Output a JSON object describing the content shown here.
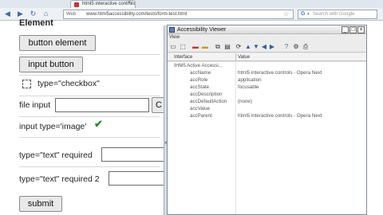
{
  "browser": {
    "tab_title": "html5 interactive controls",
    "url_prefix": "Web",
    "url": "www.html5accessibility.com/tests/form-test.html",
    "search_placeholder": "Search with Google",
    "search_engine_letter": "G"
  },
  "page": {
    "heading": "Element",
    "button_element_label": "button element",
    "input_button_label": "input button",
    "checkbox_label": "type=\"checkbox\"",
    "file_input_label": "file input",
    "file_choose_label": "C",
    "image_label": "input type='image'",
    "text_required_label": "type=\"text\" required",
    "text_required2_label": "type=\"text\" required 2",
    "submit_label": "submit"
  },
  "accessibility_viewer": {
    "title": "Accessibility Viewer",
    "menu": "View",
    "columns": [
      "Interface",
      "Value"
    ],
    "rows": [
      {
        "name": "IHM5 Active Accessi...",
        "value": ""
      },
      {
        "name": "accName",
        "value": "html5 interactive controls - Opera Next"
      },
      {
        "name": "accRole",
        "value": "application"
      },
      {
        "name": "accState",
        "value": "focusable"
      },
      {
        "name": "accDescription",
        "value": ""
      },
      {
        "name": "accDefaultAction",
        "value": "(none)"
      },
      {
        "name": "accValue",
        "value": ""
      },
      {
        "name": "accParent",
        "value": "html5 interactive controls - Opera Next"
      }
    ]
  },
  "icons": {
    "back": "back-icon",
    "forward": "forward-icon",
    "reload": "reload-icon",
    "home": "home-icon",
    "check": "checkmark-icon",
    "collapse": "chevron-right-icon"
  },
  "colors": {
    "check_green": "#2f8a2f",
    "link_blue": "#3d6aa8"
  }
}
